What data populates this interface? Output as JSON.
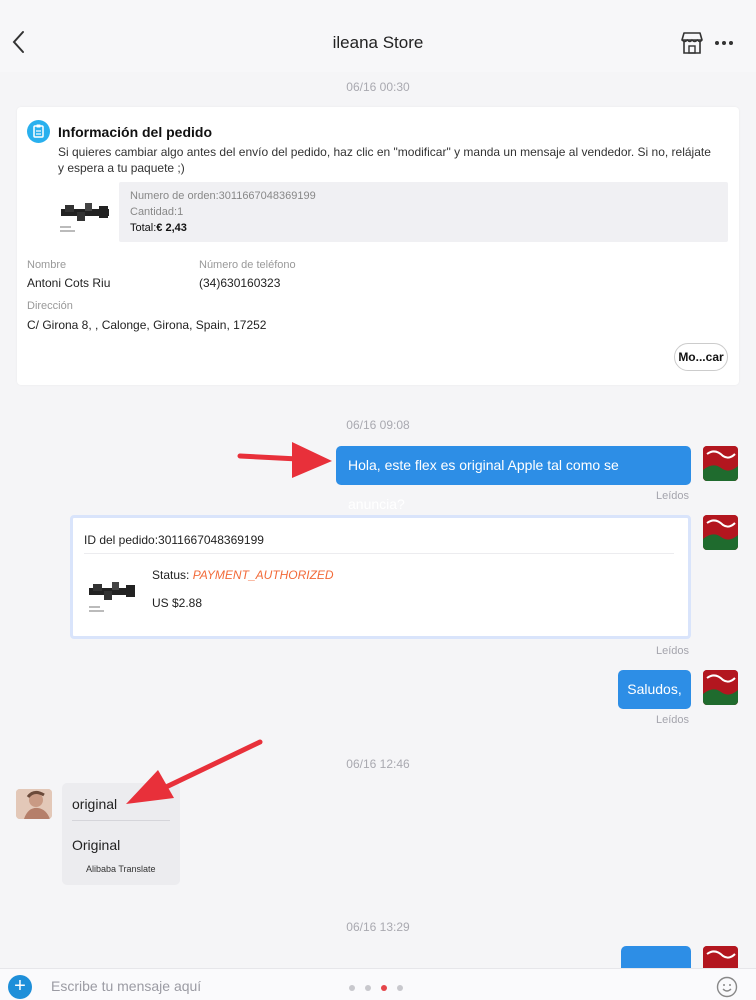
{
  "header": {
    "title": "ileana Store",
    "back_icon": "chevron-left-icon",
    "store_icon": "store-icon",
    "more_icon": "more-horizontal-icon"
  },
  "timestamps": [
    "06/16 00:30",
    "06/16 09:08",
    "06/16 12:46",
    "06/16 13:29"
  ],
  "order_card": {
    "title": "Información del pedido",
    "notice": "Si quieres cambiar algo antes del envío del pedido, haz clic en \"modificar\" y manda un mensaje al vendedor.  Si no, relájate y espera a tu paquete ;)",
    "order_number": "Numero de orden:3011667048369199",
    "quantity": "Cantidad:1",
    "total_label": "Total:",
    "total_value": "€ 2,43",
    "name_label": "Nombre",
    "name_value": "Antoni Cots Riu",
    "phone_label": "Número de teléfono",
    "phone_value": "(34)630160323",
    "address_label": "Dirección",
    "address_value": "C/ Girona 8, , Calonge, Girona, Spain, 17252",
    "modify_button": "Mo...car"
  },
  "messages": {
    "sent_1": "Hola, este flex es original Apple tal como se anuncia?",
    "read_label": "Leídos",
    "product_card": {
      "order_id": "ID del pedido:3011667048369199",
      "status_label": "Status: ",
      "status_value": "PAYMENT_AUTHORIZED",
      "price": "US $2.88"
    },
    "sent_2": "Saludos,",
    "received_original": "original",
    "received_translated": "Original",
    "translate_source": "Alibaba Translate"
  },
  "composer": {
    "placeholder": "Escribe tu mensaje aquí",
    "page_dots": 4,
    "active_dot": 3
  },
  "colors": {
    "accent_blue": "#2d8ee6",
    "annotation_red": "#e8303a",
    "status_orange": "#f26a38"
  }
}
